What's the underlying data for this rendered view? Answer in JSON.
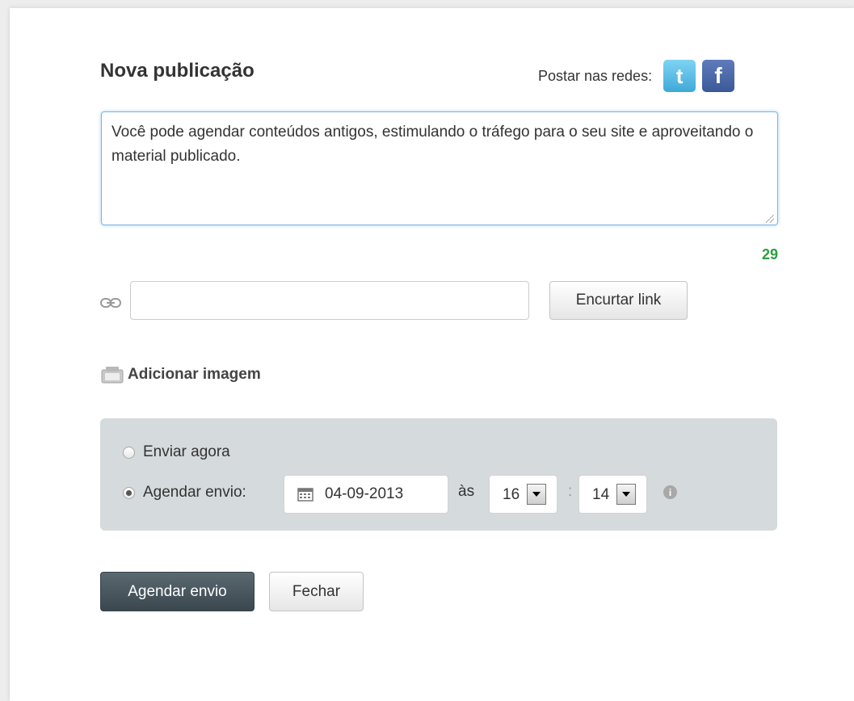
{
  "dialog": {
    "title": "Nova publicação"
  },
  "networks": {
    "label": "Postar nas redes:",
    "twitter": {
      "glyph": "t",
      "icon": "twitter-icon",
      "color": "#3fa9d9"
    },
    "facebook": {
      "glyph": "f",
      "icon": "facebook-icon",
      "color": "#3b5998"
    }
  },
  "post": {
    "text": "Você pode agendar conteúdos antigos, estimulando o tráfego para o seu site e aproveitando o material publicado.",
    "chars_remaining": "29"
  },
  "link": {
    "icon": "link-icon",
    "value": "",
    "shorten_label": "Encurtar link"
  },
  "image": {
    "icon": "image-icon",
    "label": "Adicionar imagem"
  },
  "schedule": {
    "send_now_label": "Enviar agora",
    "schedule_label": "Agendar envio:",
    "selected": "schedule",
    "date": "04-09-2013",
    "at_label": "às",
    "hour": "16",
    "minute": "14",
    "separator": ":",
    "info_glyph": "i"
  },
  "actions": {
    "schedule_button": "Agendar envio",
    "close_button": "Fechar"
  },
  "colors": {
    "counter": "#2e9d3d",
    "primary_button": "#3b474e",
    "schedule_panel": "#d5dadc"
  }
}
